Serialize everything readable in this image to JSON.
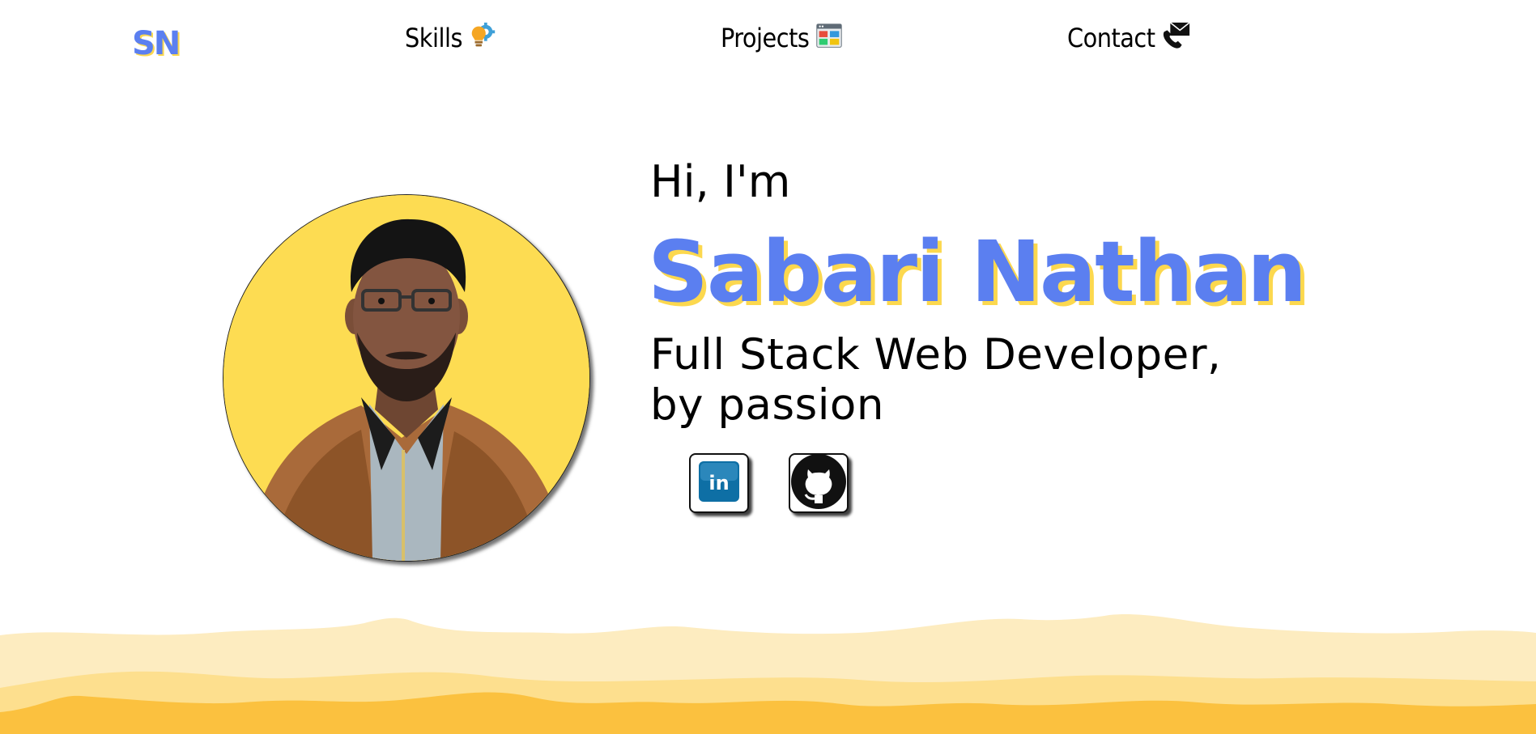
{
  "nav": {
    "logo": "SN",
    "items": [
      {
        "label": "Skills",
        "icon": "lightbulb-gear-icon"
      },
      {
        "label": "Projects",
        "icon": "dashboard-window-icon"
      },
      {
        "label": "Contact",
        "icon": "phone-envelope-icon"
      }
    ]
  },
  "hero": {
    "greeting": "Hi, I'm",
    "name": "Sabari Nathan",
    "tagline_line1": "Full Stack Web Developer,",
    "tagline_line2": "by passion"
  },
  "social": [
    {
      "icon": "linkedin-icon"
    },
    {
      "icon": "github-icon"
    }
  ],
  "colors": {
    "brand_blue": "#5b7ff0",
    "accent_yellow": "#fcd84e",
    "avatar_bg": "#fddc52",
    "hill_light": "#fdecc0",
    "hill_mid": "#fddf8e",
    "hill_dark": "#fbc13f"
  }
}
